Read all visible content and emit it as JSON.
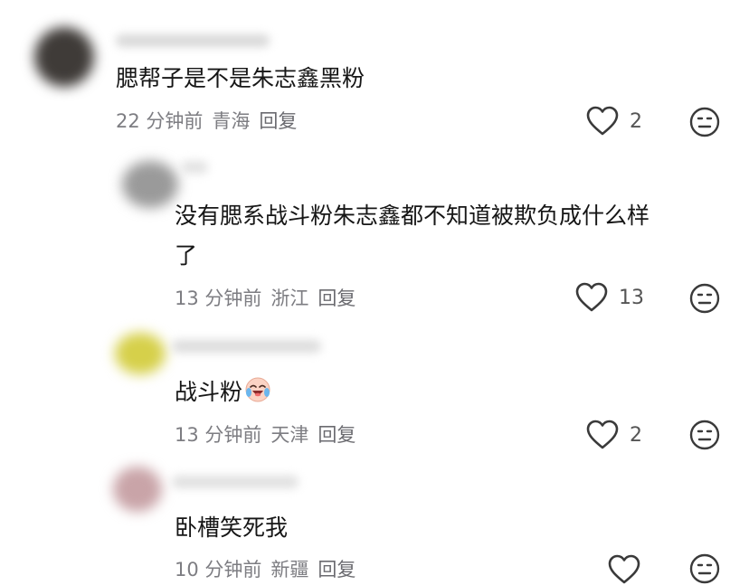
{
  "comments": [
    {
      "text": "腮帮子是不是朱志鑫黑粉",
      "time": "22 分钟前",
      "location": "青海",
      "reply": "回复",
      "likes": "2",
      "avatar_color": "#3f3b38"
    },
    {
      "text_line1": "没有腮系战斗粉朱志鑫都不知道被欺负成什么样",
      "text_line2": "了",
      "time": "13 分钟前",
      "location": "浙江",
      "reply": "回复",
      "likes": "13",
      "avatar_color": "#9a9a9a"
    },
    {
      "text": "战斗粉",
      "emoji": "crying-laughing-face-icon",
      "time": "13 分钟前",
      "location": "天津",
      "reply": "回复",
      "likes": "2",
      "avatar_color": "#d6d04a"
    },
    {
      "text": "卧槽笑死我",
      "time": "10 分钟前",
      "location": "新疆",
      "reply": "回复",
      "likes": "",
      "avatar_color": "#c9a4a8"
    }
  ]
}
